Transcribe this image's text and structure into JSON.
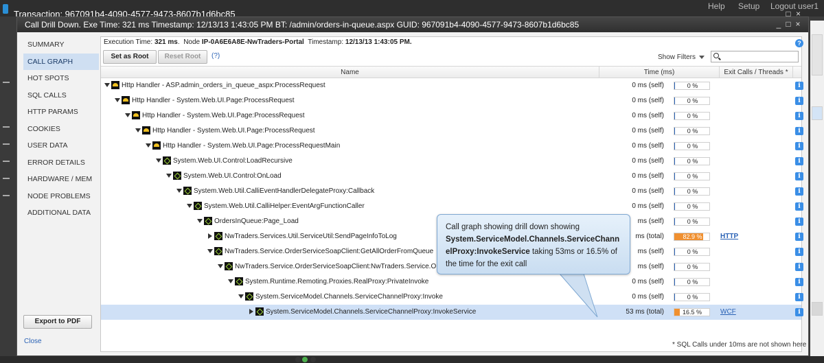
{
  "background_window": {
    "title": "Transaction: 967091b4-4090-4577-9473-8607b1d6bc85",
    "menu": [
      "Help",
      "Setup",
      "Logout user1"
    ],
    "window_controls": "_ □ ×"
  },
  "dialog": {
    "title": "Call Drill Down.  Exe Time: 321 ms  Timestamp: 12/13/13 1:43:05 PM  BT: /admin/orders-in-queue.aspx GUID: 967091b4-4090-4577-9473-8607b1d6bc85",
    "controls": {
      "minimize": "_",
      "maximize": "□",
      "close": "×"
    }
  },
  "sidebar": {
    "items": [
      {
        "label": "SUMMARY",
        "active": false
      },
      {
        "label": "CALL GRAPH",
        "active": true
      },
      {
        "label": "HOT SPOTS",
        "active": false
      },
      {
        "label": "SQL CALLS",
        "active": false
      },
      {
        "label": "HTTP PARAMS",
        "active": false
      },
      {
        "label": "COOKIES",
        "active": false
      },
      {
        "label": "USER DATA",
        "active": false
      },
      {
        "label": "ERROR DETAILS",
        "active": false
      },
      {
        "label": "HARDWARE / MEM",
        "active": false
      },
      {
        "label": "NODE PROBLEMS",
        "active": false
      },
      {
        "label": "ADDITIONAL DATA",
        "active": false
      }
    ],
    "export_label": "Export to PDF",
    "close_label": "Close"
  },
  "content": {
    "exec_label": "Execution Time:",
    "exec_value": "321 ms",
    "node_label": "Node",
    "node_value": "IP-0A6E6A8E-NwTraders-Portal",
    "timestamp_label": "Timestamp:",
    "timestamp_value": "12/13/13 1:43:05 PM.",
    "help": "?",
    "set_as_root": "Set as Root",
    "reset_root": "Reset Root",
    "question_link": "(?)",
    "show_filters": "Show Filters",
    "search_placeholder": "",
    "columns": {
      "name": "Name",
      "time": "Time (ms)",
      "exit": "Exit Calls / Threads *"
    },
    "footnote": "* SQL Calls under 10ms are not shown here"
  },
  "rows": [
    {
      "indent": 0,
      "expand": "down",
      "icon": "http",
      "name": "Http Handler - ASP.admin_orders_in_queue_aspx:ProcessRequest",
      "time": "0 ms (self)",
      "pct": "0 %",
      "pct_value": 0,
      "exit": "",
      "selected": false
    },
    {
      "indent": 1,
      "expand": "down",
      "icon": "http",
      "name": "Http Handler - System.Web.UI.Page:ProcessRequest",
      "time": "0 ms (self)",
      "pct": "0 %",
      "pct_value": 0,
      "exit": "",
      "selected": false
    },
    {
      "indent": 2,
      "expand": "down",
      "icon": "http",
      "name": "Http Handler - System.Web.UI.Page:ProcessRequest",
      "time": "0 ms (self)",
      "pct": "0 %",
      "pct_value": 0,
      "exit": "",
      "selected": false
    },
    {
      "indent": 3,
      "expand": "down",
      "icon": "http",
      "name": "Http Handler - System.Web.UI.Page:ProcessRequest",
      "time": "0 ms (self)",
      "pct": "0 %",
      "pct_value": 0,
      "exit": "",
      "selected": false
    },
    {
      "indent": 4,
      "expand": "down",
      "icon": "http",
      "name": "Http Handler - System.Web.UI.Page:ProcessRequestMain",
      "time": "0 ms (self)",
      "pct": "0 %",
      "pct_value": 0,
      "exit": "",
      "selected": false
    },
    {
      "indent": 5,
      "expand": "down",
      "icon": "code",
      "name": "System.Web.UI.Control:LoadRecursive",
      "time": "0 ms (self)",
      "pct": "0 %",
      "pct_value": 0,
      "exit": "",
      "selected": false
    },
    {
      "indent": 6,
      "expand": "down",
      "icon": "code",
      "name": "System.Web.UI.Control:OnLoad",
      "time": "0 ms (self)",
      "pct": "0 %",
      "pct_value": 0,
      "exit": "",
      "selected": false
    },
    {
      "indent": 7,
      "expand": "down",
      "icon": "code",
      "name": "System.Web.Util.CalliEventHandlerDelegateProxy:Callback",
      "time": "0 ms (self)",
      "pct": "0 %",
      "pct_value": 0,
      "exit": "",
      "selected": false
    },
    {
      "indent": 8,
      "expand": "down",
      "icon": "code",
      "name": "System.Web.Util.CalliHelper:EventArgFunctionCaller",
      "time": "0 ms (self)",
      "pct": "0 %",
      "pct_value": 0,
      "exit": "",
      "selected": false
    },
    {
      "indent": 9,
      "expand": "down",
      "icon": "code",
      "name": "OrdersInQueue:Page_Load",
      "time": "ms (self)",
      "pct": "0 %",
      "pct_value": 0,
      "exit": "",
      "selected": false
    },
    {
      "indent": 10,
      "expand": "right",
      "icon": "code",
      "name": "NwTraders.Services.Util.ServiceUtil:SendPageInfoToLog",
      "time": "ms (total)",
      "pct": "82.9 %",
      "pct_value": 82.9,
      "exit": "HTTP",
      "selected": false
    },
    {
      "indent": 10,
      "expand": "down",
      "icon": "code",
      "name": "NwTraders.Service.OrderServiceSoapClient:GetAllOrderFromQueue",
      "time": "ms (self)",
      "pct": "0 %",
      "pct_value": 0,
      "exit": "",
      "selected": false
    },
    {
      "indent": 11,
      "expand": "down",
      "icon": "code",
      "name": "NwTraders.Service.OrderServiceSoapClient:NwTraders.Service.O",
      "time": "ms (self)",
      "pct": "0 %",
      "pct_value": 0,
      "exit": "",
      "selected": false
    },
    {
      "indent": 12,
      "expand": "down",
      "icon": "code",
      "name": "System.Runtime.Remoting.Proxies.RealProxy:PrivateInvoke",
      "time": "0 ms (self)",
      "pct": "0 %",
      "pct_value": 0,
      "exit": "",
      "selected": false
    },
    {
      "indent": 13,
      "expand": "down",
      "icon": "code",
      "name": "System.ServiceModel.Channels.ServiceChannelProxy:Invoke",
      "time": "0 ms (self)",
      "pct": "0 %",
      "pct_value": 0,
      "exit": "",
      "selected": false
    },
    {
      "indent": 14,
      "expand": "right",
      "icon": "code",
      "name": "System.ServiceModel.Channels.ServiceChannelProxy:InvokeService",
      "time": "53 ms (total)",
      "pct": "16.5 %",
      "pct_value": 16.5,
      "exit": "WCF",
      "selected": true
    }
  ],
  "callout": {
    "line1": "Call graph showing drill down showing",
    "bold": "System.ServiceModel.Channels.ServiceChannelProxy:InvokeService",
    "rest": "taking 53ms or 16.5% of the time for the exit call"
  },
  "colors": {
    "accent": "#3a8ee6",
    "bar_fill": "#f09030",
    "selected_row": "#cfe0f6",
    "link": "#2a62b5"
  }
}
